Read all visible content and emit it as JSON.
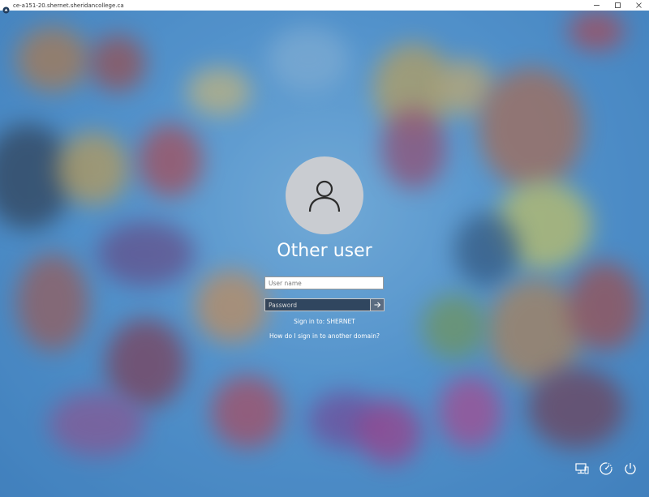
{
  "window": {
    "title": "ce-a151-20.shernet.sheridancollege.ca"
  },
  "login": {
    "user_display_name": "Other user",
    "username_placeholder": "User name",
    "password_placeholder": "Password",
    "sign_in_to": "Sign in to: SHERNET",
    "domain_help_link": "How do I sign in to another domain?"
  },
  "tray": {
    "icons": [
      "network-icon",
      "ease-of-access-icon",
      "power-icon"
    ]
  },
  "colors": {
    "background": "#4a8fcb",
    "avatar_circle": "#c9ccd1",
    "text": "#ffffff"
  }
}
